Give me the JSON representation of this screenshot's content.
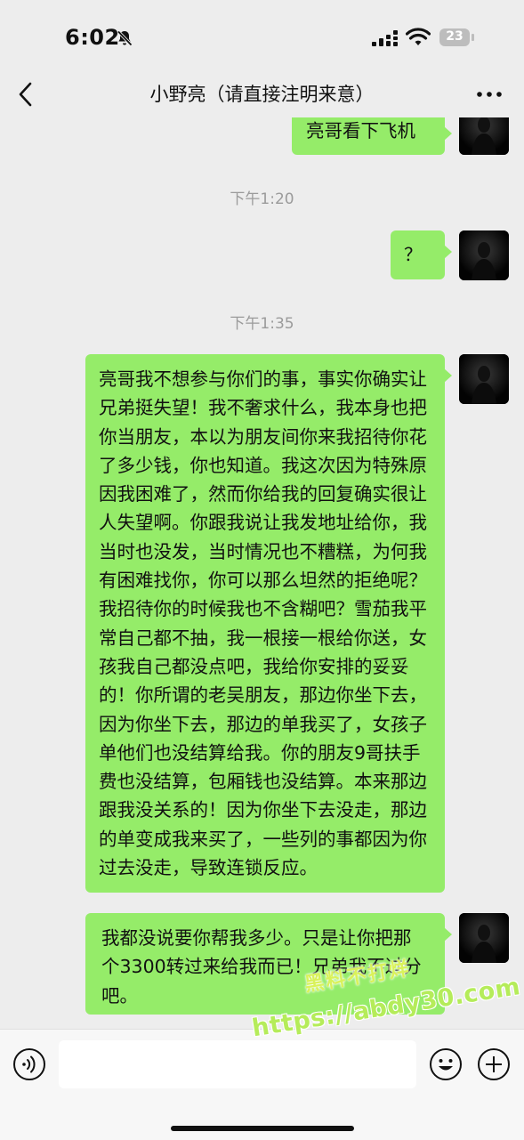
{
  "status_bar": {
    "time": "6:02",
    "battery_level": "23",
    "icons": [
      "bell-slash-icon",
      "cellular-signal-icon",
      "wifi-icon",
      "battery-icon"
    ]
  },
  "nav": {
    "title": "小野亮（请直接注明来意）",
    "icons": [
      "chevron-left-icon",
      "ellipsis-icon"
    ]
  },
  "chat": {
    "messages": [
      {
        "type": "text",
        "text": "亮哥看下飞机"
      },
      {
        "type": "timestamp",
        "text": "下午1:20"
      },
      {
        "type": "text",
        "text": "？"
      },
      {
        "type": "timestamp",
        "text": "下午1:35"
      },
      {
        "type": "text",
        "text": "亮哥我不想参与你们的事，事实你确实让兄弟挺失望！我不奢求什么，我本身也把你当朋友，本以为朋友间你来我招待你花了多少钱，你也知道。我这次因为特殊原因我困难了，然而你给我的回复确实很让人失望啊。你跟我说让我发地址给你，我当时也没发，当时情况也不糟糕，为何我有困难找你，你可以那么坦然的拒绝呢？我招待你的时候我也不含糊吧？雪茄我平常自己都不抽，我一根接一根给你送，女孩我自己都没点吧，我给你安排的妥妥的！你所谓的老吴朋友，那边你坐下去，因为你坐下去，那边的单我买了，女孩子单他们也没结算给我。你的朋友9哥扶手费也没结算，包厢钱也没结算。本来那边跟我没关系的！因为你坐下去没走，那边的单变成我来买了，一些列的事都因为你过去没走，导致连锁反应。"
      },
      {
        "type": "text",
        "text": "我都没说要你帮我多少。只是让你把那个3300转过来给我而已！兄弟我不过分吧。"
      }
    ]
  },
  "watermark": {
    "line1": "黑料不打烊",
    "line2": "https://abdy30.com"
  },
  "input_bar": {
    "icons": [
      "voice-icon",
      "emoji-icon",
      "plus-icon"
    ],
    "value": ""
  },
  "colors": {
    "background": "#ededed",
    "bubble": "#95ec69",
    "timestamp": "#9b9b9b",
    "input_bar": "#f7f7f7"
  }
}
